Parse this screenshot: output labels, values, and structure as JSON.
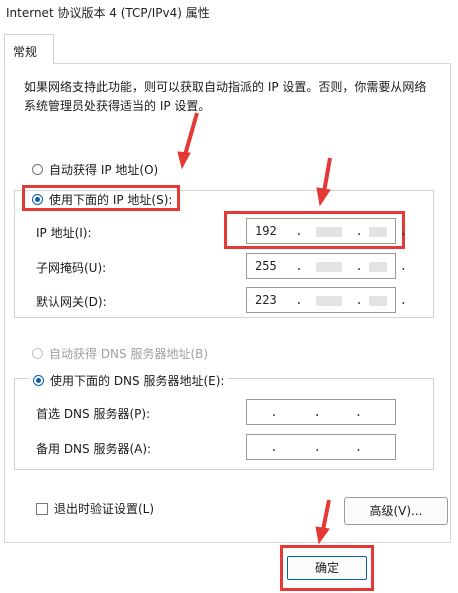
{
  "window": {
    "title": "Internet 协议版本 4 (TCP/IPv4) 属性"
  },
  "tabs": [
    {
      "label": "常规"
    }
  ],
  "description": "如果网络支持此功能，则可以获取自动指派的 IP 设置。否则，你需要从网络系统管理员处获得适当的 IP 设置。",
  "ip": {
    "auto_label": "自动获得 IP 地址(O)",
    "manual_label": "使用下面的 IP 地址(S):",
    "address_label": "IP 地址(I):",
    "mask_label": "子网掩码(U):",
    "gateway_label": "默认网关(D):",
    "address_first": "192",
    "mask_first": "255",
    "gateway_first": "223",
    "separator": "."
  },
  "dns": {
    "auto_label": "自动获得 DNS 服务器地址(B)",
    "manual_label": "使用下面的 DNS 服务器地址(E):",
    "preferred_label": "首选 DNS 服务器(P):",
    "alternate_label": "备用 DNS 服务器(A):",
    "separator": "."
  },
  "validate_label": "退出时验证设置(L)",
  "advanced_label": "高级(V)...",
  "ok_label": "确定",
  "colors": {
    "highlight": "#e53935",
    "accent": "#0b5cad"
  }
}
